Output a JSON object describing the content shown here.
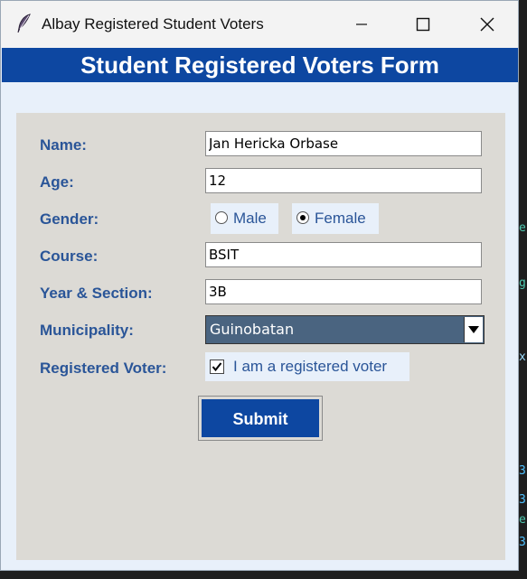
{
  "window": {
    "title": "Albay Registered Student Voters",
    "icon": "feather-icon"
  },
  "window_controls": {
    "minimize_icon": "minimize-icon",
    "maximize_icon": "maximize-icon",
    "close_icon": "close-icon"
  },
  "form": {
    "heading": "Student Registered Voters Form",
    "fields": {
      "name": {
        "label": "Name:",
        "value": "Jan Hericka Orbase"
      },
      "age": {
        "label": "Age:",
        "value": "12"
      },
      "gender": {
        "label": "Gender:",
        "options": [
          "Male",
          "Female"
        ],
        "selected": "Female"
      },
      "course": {
        "label": "Course:",
        "value": "BSIT"
      },
      "year_section": {
        "label": "Year & Section:",
        "value": "3B"
      },
      "municipality": {
        "label": "Municipality:",
        "selected": "Guinobatan"
      },
      "registered_voter": {
        "label": "Registered Voter:",
        "checkbox_label": "I am a registered voter",
        "checked": true
      }
    },
    "submit_label": "Submit"
  },
  "colors": {
    "header_bg": "#0d47a1",
    "label_text": "#2a5598",
    "panel_bg": "#dcdad5",
    "window_bg": "#e8f0fa",
    "select_bg": "#4a6480"
  }
}
